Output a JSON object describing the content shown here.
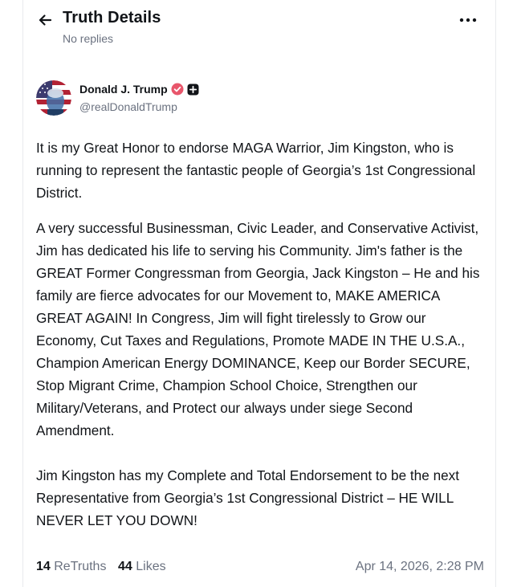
{
  "header": {
    "title": "Truth Details",
    "subtitle": "No replies"
  },
  "author": {
    "name": "Donald J. Trump",
    "handle": "@realDonaldTrump"
  },
  "post": {
    "paragraphs": [
      "It is my Great Honor to endorse MAGA Warrior, Jim Kingston, who is running to represent the fantastic people of Georgia’s 1st Congressional District.",
      "A very successful Businessman, Civic Leader, and Conservative Activist, Jim has dedicated his life to serving his Community. Jim's father is the GREAT Former Congressman from Georgia, Jack Kingston – He and his family are fierce advocates for our Movement to, MAKE AMERICA GREAT AGAIN! In Congress, Jim will fight tirelessly to Grow our Economy, Cut Taxes and Regulations, Promote MADE IN THE U.S.A., Champion American Energy DOMINANCE, Keep our Border SECURE, Stop Migrant Crime, Champion School Choice, Strengthen our Military/Veterans, and Protect our always under siege Second Amendment.",
      "Jim Kingston has my Complete and Total Endorsement to be the next Representative from Georgia’s 1st Congressional District – HE WILL NEVER LET YOU DOWN!"
    ]
  },
  "stats": {
    "retruths_count": "14",
    "retruths_label": "ReTruths",
    "likes_count": "44",
    "likes_label": "Likes",
    "timestamp": "Apr 14, 2026, 2:28 PM"
  },
  "colors": {
    "verified_badge": "#e8566b",
    "text_primary": "#111418",
    "text_secondary": "#6b7280"
  },
  "icons": [
    "arrow-left-icon",
    "more-horizontal-icon",
    "verified-badge-icon",
    "plus-badge-icon"
  ]
}
